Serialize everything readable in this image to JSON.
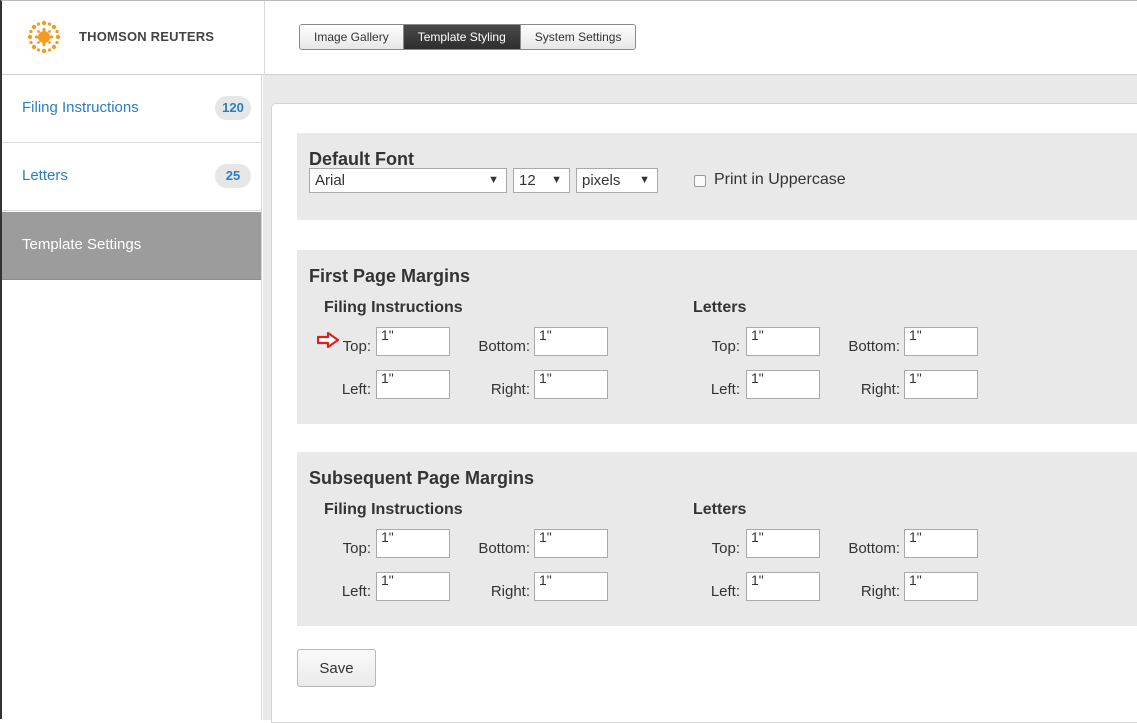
{
  "brand": {
    "name": "THOMSON REUTERS"
  },
  "tabs": [
    {
      "label": "Image Gallery",
      "active": false
    },
    {
      "label": "Template Styling",
      "active": true
    },
    {
      "label": "System Settings",
      "active": false
    }
  ],
  "sidebar": {
    "items": [
      {
        "label": "Filing Instructions",
        "count": "120"
      },
      {
        "label": "Letters",
        "count": "25"
      },
      {
        "label": "Template Settings"
      }
    ]
  },
  "default_font": {
    "title": "Default Font",
    "font_family": "Arial",
    "font_size": "12",
    "unit": "pixels",
    "uppercase_label": "Print in Uppercase",
    "uppercase_checked": false
  },
  "first_page": {
    "title": "First Page Margins",
    "filing": {
      "title": "Filing Instructions",
      "top": "1\"",
      "bottom": "1\"",
      "left": "1\"",
      "right": "1\""
    },
    "letters": {
      "title": "Letters",
      "top": "1\"",
      "bottom": "1\"",
      "left": "1\"",
      "right": "1\""
    }
  },
  "subsequent_page": {
    "title": "Subsequent Page Margins",
    "filing": {
      "title": "Filing Instructions",
      "top": "1\"",
      "bottom": "1\"",
      "left": "1\"",
      "right": "1\""
    },
    "letters": {
      "title": "Letters",
      "top": "1\"",
      "bottom": "1\"",
      "left": "1\"",
      "right": "1\""
    }
  },
  "labels": {
    "top": "Top:",
    "bottom": "Bottom:",
    "left": "Left:",
    "right": "Right:"
  },
  "actions": {
    "save_label": "Save"
  },
  "icons": {
    "logo": "thomson-reuters-logo",
    "arrow": "red-arrow-pointer-icon",
    "caret": "caret-down-icon"
  },
  "colors": {
    "accent": "#2a7fc0",
    "active_tab": "#3a3a3a",
    "active_sidebar": "#9c9c9c",
    "pointer": "#e0201b",
    "logo": "#f39a21"
  }
}
